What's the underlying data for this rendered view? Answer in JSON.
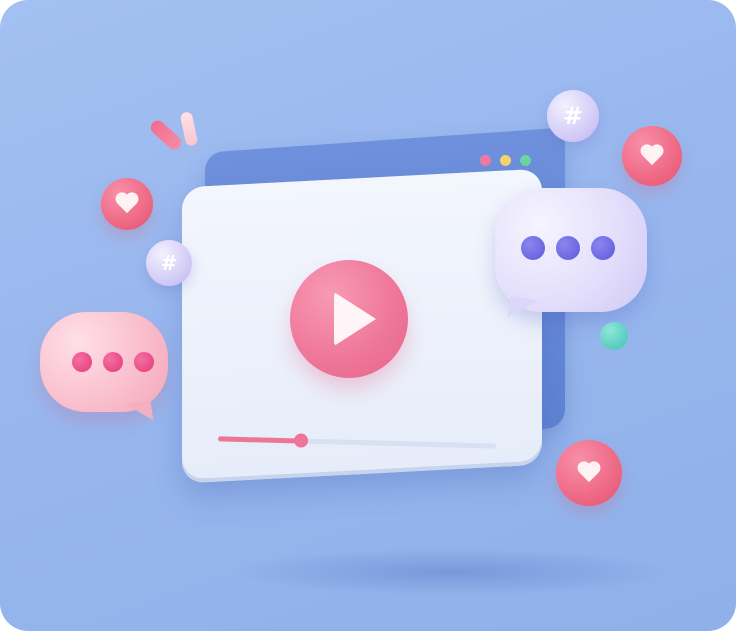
{
  "scene": {
    "description_type": "3d-illustration",
    "background_color": "#98b7ee",
    "player": {
      "play_icon": "play-icon",
      "accent_color": "#ee7598",
      "progress": 0.3
    },
    "window_dots": [
      {
        "color": "#f07aa0"
      },
      {
        "color": "#f4d56a"
      },
      {
        "color": "#6ad6a0"
      }
    ],
    "bubbles": [
      {
        "icon": "chat-bubble-icon",
        "color": "#cfc8f5"
      },
      {
        "icon": "chat-bubble-icon",
        "color": "#f3a7ba"
      }
    ],
    "hash_symbol": "#",
    "icons": [
      "heart-icon",
      "hashtag-icon",
      "chat-bubble-icon",
      "play-icon"
    ]
  }
}
